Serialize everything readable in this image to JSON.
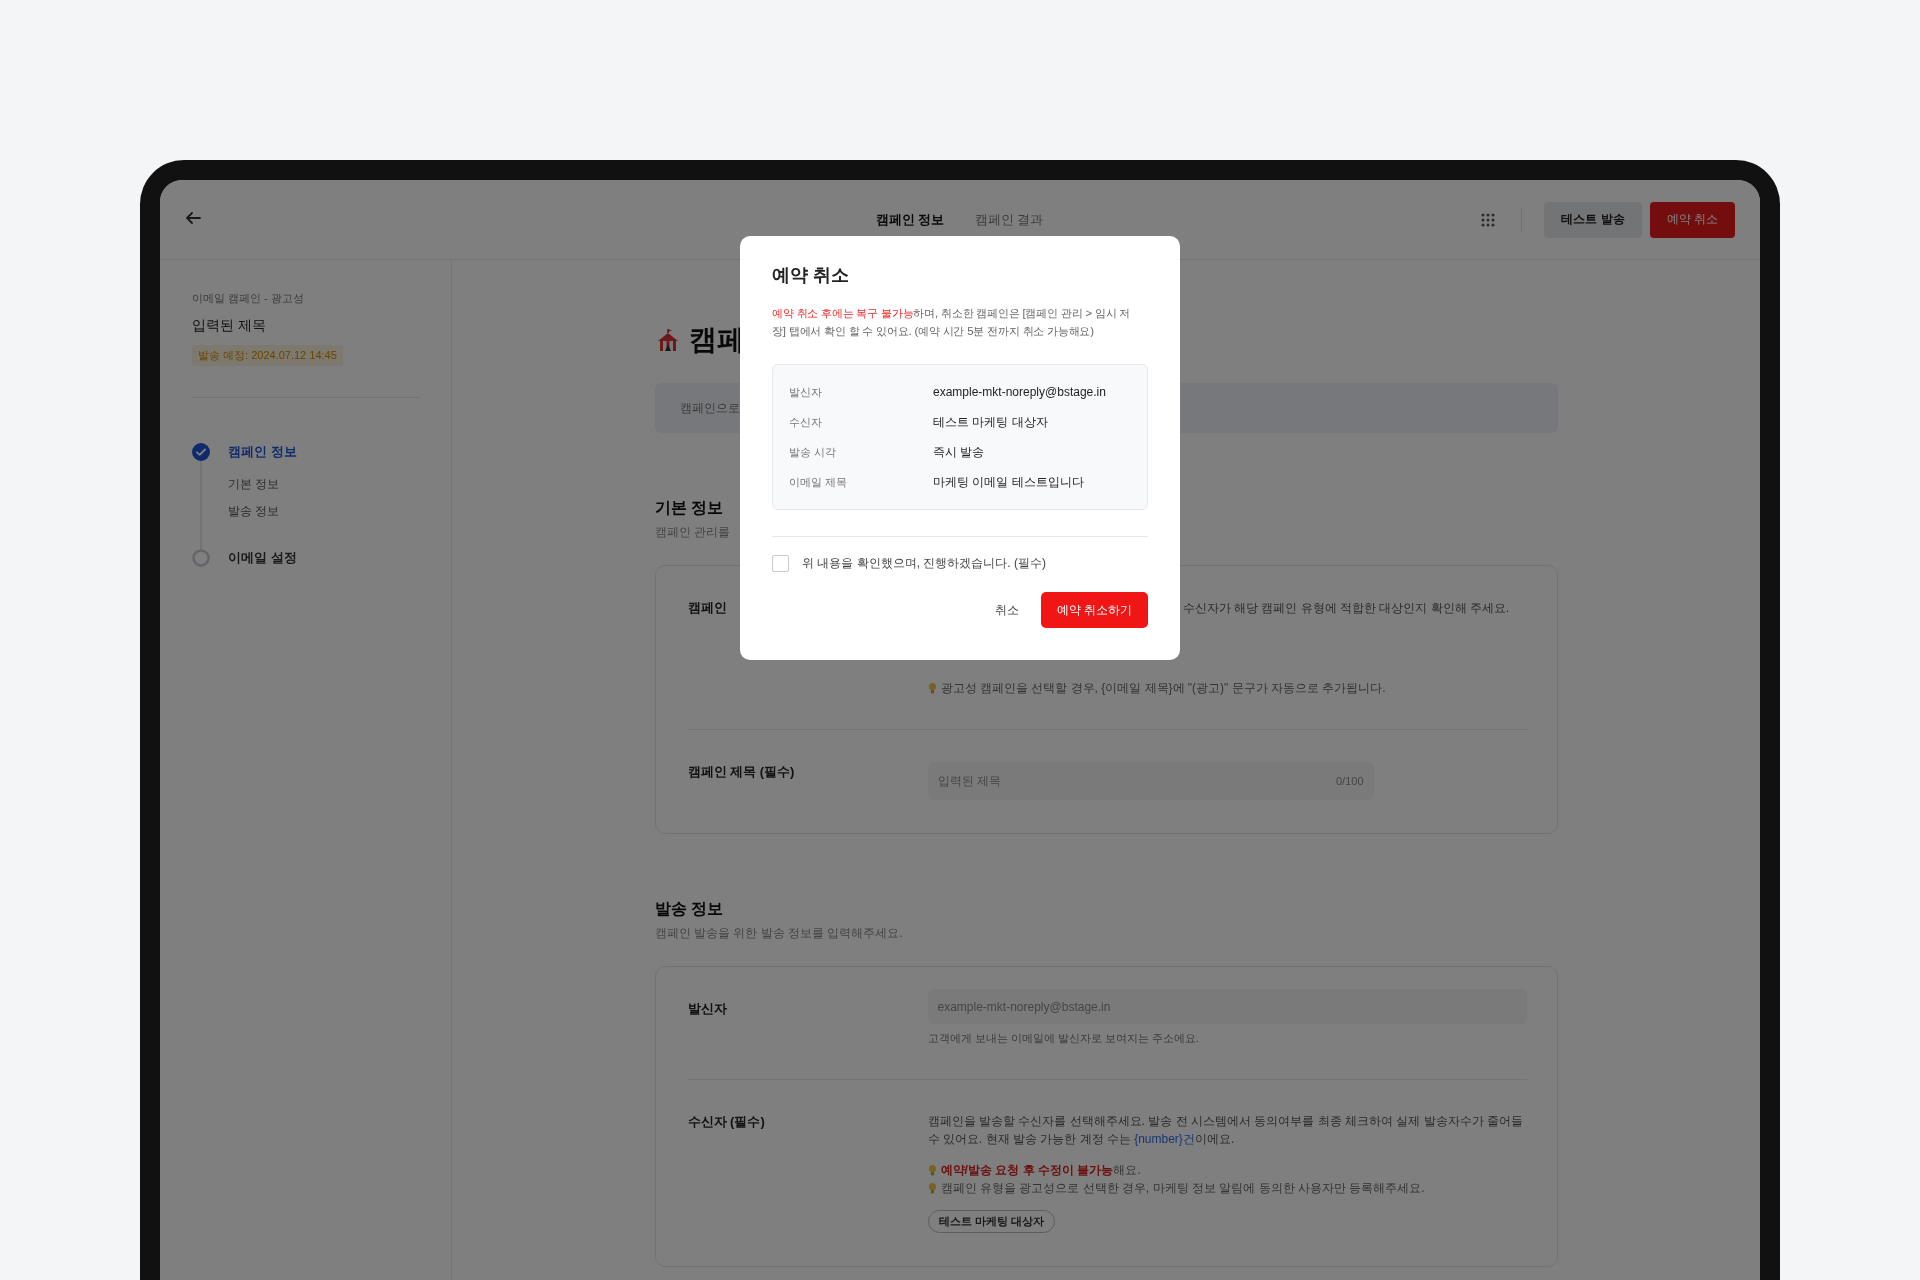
{
  "header": {
    "tabs": [
      {
        "label": "캠페인 정보",
        "selected": true
      },
      {
        "label": "캠페인 결과",
        "selected": false
      }
    ],
    "buttons": [
      {
        "label": "테스트 발송",
        "kind": "secondary"
      },
      {
        "label": "예약 취소",
        "kind": "danger"
      }
    ]
  },
  "sidebar": {
    "category": "이메일 캠페인 - 광고성",
    "title": "입력된 제목",
    "schedule_badge": "발송 예정: 2024.07.12 14:45",
    "steps": [
      {
        "label": "캠페인 정보",
        "done": true,
        "children": [
          {
            "label": "기본 정보"
          },
          {
            "label": "발송 정보"
          }
        ]
      },
      {
        "label": "이메일 설정",
        "done": false
      }
    ]
  },
  "main": {
    "title": "캠페",
    "banner": "캠페인으로",
    "sections": [
      {
        "heading": "기본 정보",
        "subtitle": "캠페인 관리를",
        "fields": [
          {
            "kind": "type",
            "label": "캠페인",
            "note": "수신자가 해당 캠페인 유형에 적합한 대상인지 확인해 주세요.",
            "tips": [
              "광고성 캠페인을 선택할 경우, {이메일 제목}에 \"(광고)\" 문구가 자동으로 추가됩니다."
            ]
          },
          {
            "kind": "input",
            "label": "캠페인 제목 (필수)",
            "value": "입력된 제목",
            "disabled": true,
            "counter": "0/100"
          }
        ]
      },
      {
        "heading": "발송 정보",
        "subtitle": "캠페인 발송을 위한 발송 정보를 입력해주세요.",
        "fields": [
          {
            "kind": "input",
            "label": "발신자",
            "value": "example-mkt-noreply@bstage.in",
            "disabled": true,
            "help": "고객에게 보내는 이메일에 발신자로 보여지는 주소에요."
          },
          {
            "kind": "recipients",
            "label": "수신자 (필수)",
            "description": {
              "before": "캠페인을 발송할 수신자를 선택해주세요. 발송 전 시스템에서 동의여부를 최종 체크하여 실제 발송자수가 줄어들 수 있어요. 현재 발송 가능한 계정 수는 ",
              "highlight": "{number}건",
              "after": "이에요."
            },
            "tips": [
              "**예약/발송 요청 후 수정이 불가능**해요.",
              "캠페인 유형을 광고성으로 선택한 경우, 마케팅 정보 알림에 동의한 사용자만 등록해주세요."
            ],
            "chip": "테스트 마케팅 대상자"
          }
        ]
      }
    ]
  },
  "modal": {
    "title": "예약 취소",
    "description": "**예약 취소 후에는 복구 불가능**하며, 취소한 캠페인은 [캠페인 관리 > 임시 저장] 탭에서 확인 할 수 있어요. (예약 시간 5분 전까지 취소 가능해요)",
    "rows": [
      {
        "label": "발신자",
        "value": "example-mkt-noreply@bstage.in"
      },
      {
        "label": "수신자",
        "value": "테스트 마케팅 대상자"
      },
      {
        "label": "발송 시각",
        "value": "즉시 발송"
      },
      {
        "label": "이메일 제목",
        "value": "마케팅 이메일 테스트입니다"
      }
    ],
    "confirm": {
      "label": "위 내용을 확인했으며, 진행하겠습니다. (필수)",
      "checked": false
    },
    "buttons": [
      {
        "label": "취소",
        "kind": "text"
      },
      {
        "label": "예약 취소하기",
        "kind": "danger"
      }
    ]
  }
}
